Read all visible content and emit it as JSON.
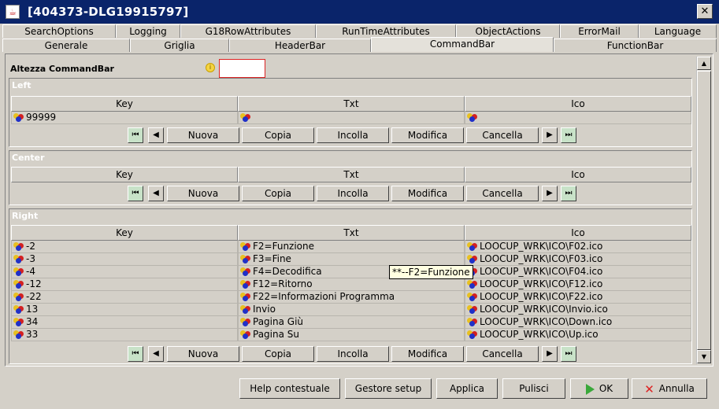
{
  "window": {
    "title": "[404373-DLG19915797]",
    "close_glyph": "✕"
  },
  "tabs": {
    "row1": [
      "SearchOptions",
      "Logging",
      "G18RowAttributes",
      "RunTimeAttributes",
      "ObjectActions",
      "ErrorMail",
      "Language"
    ],
    "row2": [
      "Generale",
      "Griglia",
      "HeaderBar",
      "CommandBar",
      "FunctionBar"
    ],
    "active": "CommandBar"
  },
  "form": {
    "height_label": "Altezza CommandBar",
    "height_value": ""
  },
  "grid": {
    "col_key": "Key",
    "col_txt": "Txt",
    "col_ico": "Ico"
  },
  "left": {
    "title": "Left",
    "rows": [
      {
        "key": "99999",
        "txt": "",
        "ico": ""
      }
    ]
  },
  "center": {
    "title": "Center",
    "rows": []
  },
  "right": {
    "title": "Right",
    "rows": [
      {
        "key": "-2",
        "txt": "F2=Funzione",
        "ico": "LOOCUP_WRK\\ICO\\F02.ico"
      },
      {
        "key": "-3",
        "txt": "F3=Fine",
        "ico": "LOOCUP_WRK\\ICO\\F03.ico"
      },
      {
        "key": "-4",
        "txt": "F4=Decodifica",
        "ico": "LOOCUP_WRK\\ICO\\F04.ico"
      },
      {
        "key": "-12",
        "txt": "F12=Ritorno",
        "ico": "LOOCUP_WRK\\ICO\\F12.ico"
      },
      {
        "key": "-22",
        "txt": "F22=Informazioni Programma",
        "ico": "LOOCUP_WRK\\ICO\\F22.ico"
      },
      {
        "key": "13",
        "txt": "Invio",
        "ico": "LOOCUP_WRK\\ICO\\Invio.ico"
      },
      {
        "key": "34",
        "txt": "Pagina Giù",
        "ico": "LOOCUP_WRK\\ICO\\Down.ico"
      },
      {
        "key": "33",
        "txt": "Pagina Su",
        "ico": "LOOCUP_WRK\\ICO\\Up.ico"
      }
    ]
  },
  "actions": {
    "nuova": "Nuova",
    "copia": "Copia",
    "incolla": "Incolla",
    "modifica": "Modifica",
    "cancella": "Cancella"
  },
  "tooltip": "**--F2=Funzione",
  "bottom": {
    "help": "Help contestuale",
    "setup": "Gestore setup",
    "apply": "Applica",
    "clear": "Pulisci",
    "ok": "OK",
    "cancel": "Annulla"
  },
  "colors": {
    "title_bar": "#0a246a",
    "dialog_bg": "#d4d0c8",
    "input_border": "#d22222",
    "tooltip_bg": "#ffffe1"
  }
}
